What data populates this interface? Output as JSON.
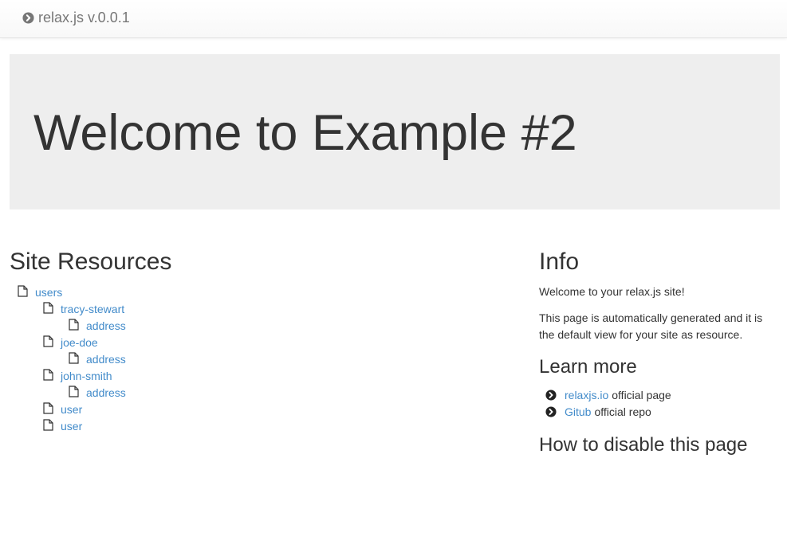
{
  "navbar": {
    "brand": "relax.js v.0.0.1",
    "brand_icon": "chevron-circle-right-icon"
  },
  "jumbotron": {
    "title": "Welcome to Example #2"
  },
  "resources": {
    "title": "Site Resources",
    "items": [
      {
        "label": "users",
        "level": 0,
        "icon": "file-icon"
      },
      {
        "label": "tracy-stewart",
        "level": 1,
        "icon": "file-icon"
      },
      {
        "label": "address",
        "level": 2,
        "icon": "file-icon"
      },
      {
        "label": "joe-doe",
        "level": 1,
        "icon": "file-icon"
      },
      {
        "label": "address",
        "level": 2,
        "icon": "file-icon"
      },
      {
        "label": "john-smith",
        "level": 1,
        "icon": "file-icon"
      },
      {
        "label": "address",
        "level": 2,
        "icon": "file-icon"
      },
      {
        "label": "user",
        "level": 1,
        "icon": "file-icon"
      },
      {
        "label": "user",
        "level": 1,
        "icon": "file-icon"
      }
    ]
  },
  "info": {
    "title": "Info",
    "welcome": "Welcome to your relax.js site!",
    "description": "This page is automatically generated and it is the default view for your site as resource."
  },
  "learn_more": {
    "title": "Learn more",
    "links": [
      {
        "link_text": "relaxjs.io",
        "suffix": "official page",
        "icon": "chevron-circle-right-icon"
      },
      {
        "link_text": "Gitub",
        "suffix": "official repo",
        "icon": "chevron-circle-right-icon"
      }
    ]
  },
  "disable": {
    "title": "How to disable this page"
  },
  "colors": {
    "link": "#428bca",
    "jumbotron_bg": "#eeeeee",
    "text": "#333333",
    "brand": "#777777"
  }
}
